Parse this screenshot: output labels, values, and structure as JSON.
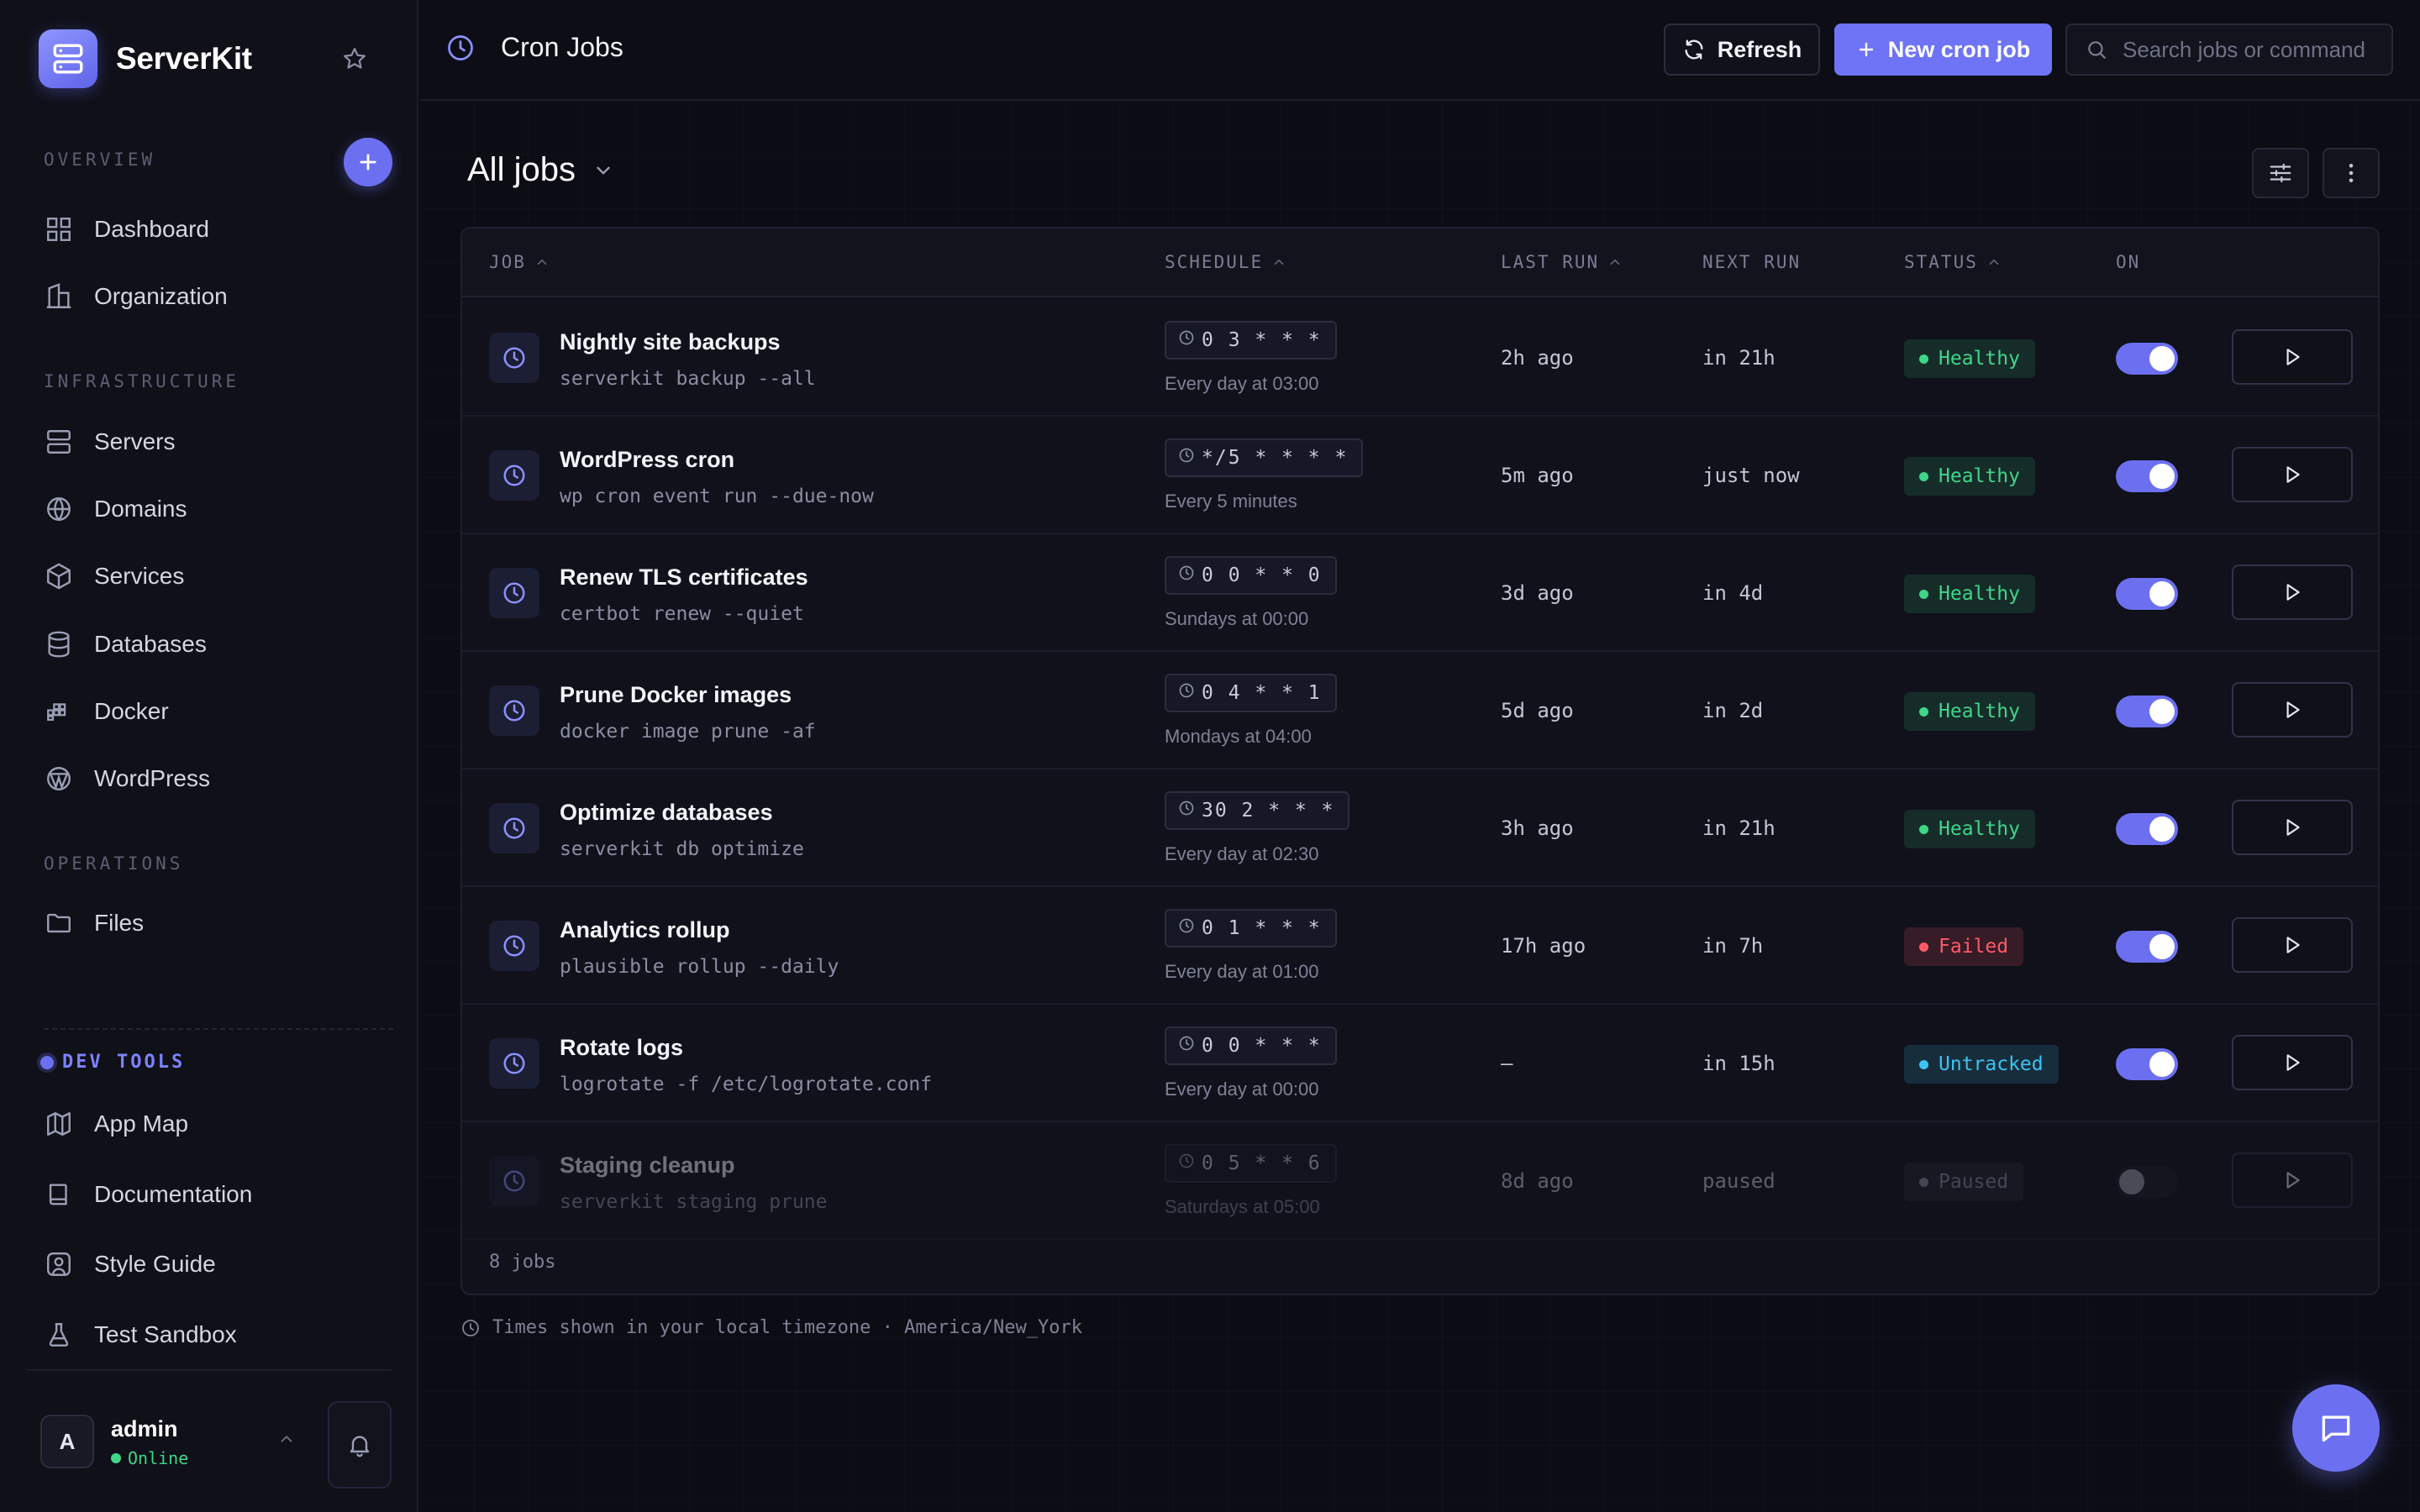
{
  "app": {
    "name": "ServerKit"
  },
  "sidebar": {
    "overview_label": "OVERVIEW",
    "overview_items": [
      {
        "label": "Dashboard",
        "icon": "grid-icon"
      },
      {
        "label": "Organization",
        "icon": "building-icon"
      }
    ],
    "infrastructure_label": "INFRASTRUCTURE",
    "infrastructure_items": [
      {
        "label": "Servers",
        "icon": "server-icon"
      },
      {
        "label": "Domains",
        "icon": "globe-icon"
      },
      {
        "label": "Services",
        "icon": "box-icon"
      },
      {
        "label": "Databases",
        "icon": "database-icon"
      },
      {
        "label": "Docker",
        "icon": "docker-icon"
      },
      {
        "label": "WordPress",
        "icon": "wordpress-icon"
      }
    ],
    "operations_label": "OPERATIONS",
    "operations_items": [
      {
        "label": "Files",
        "icon": "folder-icon"
      }
    ],
    "dev_tools_label": "DEV TOOLS",
    "dev_tools_items": [
      {
        "label": "App Map",
        "icon": "map-icon"
      },
      {
        "label": "Documentation",
        "icon": "book-icon"
      },
      {
        "label": "Style Guide",
        "icon": "palette-icon"
      },
      {
        "label": "Test Sandbox",
        "icon": "flask-icon"
      }
    ],
    "user": {
      "initial": "A",
      "name": "admin",
      "status": "Online"
    }
  },
  "header": {
    "title": "Cron Jobs",
    "refresh_label": "Refresh",
    "new_label": "New cron job",
    "search_placeholder": "Search jobs or command"
  },
  "main": {
    "view_title": "All jobs",
    "columns": {
      "job": "JOB",
      "schedule": "SCHEDULE",
      "last_run": "LAST RUN",
      "next_run": "NEXT RUN",
      "status": "STATUS",
      "on": "ON"
    },
    "jobs": [
      {
        "name": "Nightly site backups",
        "command": "serverkit backup --all",
        "schedule": "0 3 * * *",
        "schedule_desc": "Every day at 03:00",
        "last_run": "2h ago",
        "next_run": "in 21h",
        "status": "Healthy",
        "enabled": true
      },
      {
        "name": "WordPress cron",
        "command": "wp cron event run --due-now",
        "schedule": "*/5 * * * *",
        "schedule_desc": "Every 5 minutes",
        "last_run": "5m ago",
        "next_run": "just now",
        "status": "Healthy",
        "enabled": true
      },
      {
        "name": "Renew TLS certificates",
        "command": "certbot renew --quiet",
        "schedule": "0 0 * * 0",
        "schedule_desc": "Sundays at 00:00",
        "last_run": "3d ago",
        "next_run": "in 4d",
        "status": "Healthy",
        "enabled": true
      },
      {
        "name": "Prune Docker images",
        "command": "docker image prune -af",
        "schedule": "0 4 * * 1",
        "schedule_desc": "Mondays at 04:00",
        "last_run": "5d ago",
        "next_run": "in 2d",
        "status": "Healthy",
        "enabled": true
      },
      {
        "name": "Optimize databases",
        "command": "serverkit db optimize",
        "schedule": "30 2 * * *",
        "schedule_desc": "Every day at 02:30",
        "last_run": "3h ago",
        "next_run": "in 21h",
        "status": "Healthy",
        "enabled": true
      },
      {
        "name": "Analytics rollup",
        "command": "plausible rollup --daily",
        "schedule": "0 1 * * *",
        "schedule_desc": "Every day at 01:00",
        "last_run": "17h ago",
        "next_run": "in 7h",
        "status": "Failed",
        "enabled": true
      },
      {
        "name": "Rotate logs",
        "command": "logrotate -f /etc/logrotate.conf",
        "schedule": "0 0 * * *",
        "schedule_desc": "Every day at 00:00",
        "last_run": "—",
        "next_run": "in 15h",
        "status": "Untracked",
        "enabled": true
      },
      {
        "name": "Staging cleanup",
        "command": "serverkit staging prune",
        "schedule": "0 5 * * 6",
        "schedule_desc": "Saturdays at 05:00",
        "last_run": "8d ago",
        "next_run": "paused",
        "status": "Paused",
        "enabled": false
      }
    ],
    "footer_count": "8 jobs",
    "timezone_note": "Times shown in your local timezone · America/New_York"
  },
  "colors": {
    "accent": "#6c70f0",
    "healthy": "#3fd68a",
    "failed": "#ff5a6a",
    "untracked": "#3ec3f0",
    "paused": "#8a8ea3"
  }
}
